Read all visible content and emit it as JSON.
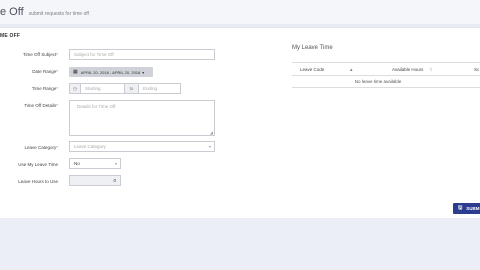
{
  "header": {
    "title": "e Off",
    "subtitle": "submit requests for time off"
  },
  "form": {
    "section_title": "ME OFF",
    "subject": {
      "label": "Time Off Subject",
      "placeholder": "Subject for Time Off"
    },
    "date_range": {
      "label": "Date Range",
      "value": "APRIL 20, 2018 - APRIL 20, 2018"
    },
    "time_range": {
      "label": "Time Range",
      "start_placeholder": "Starting",
      "separator": "to",
      "end_placeholder": "Ending"
    },
    "details": {
      "label": "Time Off Details",
      "placeholder": "Details for Time Off"
    },
    "leave_category": {
      "label": "Leave Category",
      "placeholder": "Leave Category"
    },
    "use_my_leave": {
      "label": "Use My Leave Time",
      "value": "No"
    },
    "leave_hours": {
      "label": "Leave Hours to Use",
      "value": "0"
    },
    "required_mark": "*"
  },
  "leave_time": {
    "title": "My Leave Time",
    "columns": [
      "Leave Code",
      "Available Hours",
      "Sc"
    ],
    "empty_message": "No leave time available"
  },
  "actions": {
    "submit_label": "SUBM"
  },
  "colors": {
    "accent": "#2c3d8f",
    "required": "#d9534f"
  }
}
